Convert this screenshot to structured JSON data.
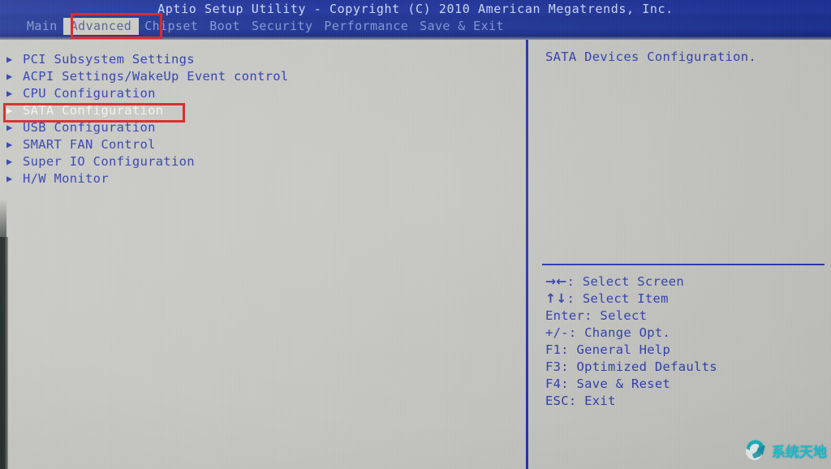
{
  "titlebar": {
    "text": "Aptio Setup Utility - Copyright (C) 2010 American Megatrends, Inc."
  },
  "menubar": {
    "items": [
      {
        "label": "Main",
        "active": false
      },
      {
        "label": "Advanced",
        "active": true
      },
      {
        "label": "Chipset",
        "active": false
      },
      {
        "label": "Boot",
        "active": false
      },
      {
        "label": "Security",
        "active": false
      },
      {
        "label": "Performance",
        "active": false
      },
      {
        "label": "Save & Exit",
        "active": false
      }
    ]
  },
  "main": {
    "options": [
      {
        "arrow": "▶",
        "label": "PCI Subsystem Settings",
        "selected": false
      },
      {
        "arrow": "▶",
        "label": "ACPI Settings/WakeUp Event control",
        "selected": false
      },
      {
        "arrow": "▶",
        "label": "CPU Configuration",
        "selected": false
      },
      {
        "arrow": "▶",
        "label": "SATA Configuration",
        "selected": true
      },
      {
        "arrow": "▶",
        "label": "USB Configuration",
        "selected": false
      },
      {
        "arrow": "▶",
        "label": "SMART FAN Control",
        "selected": false
      },
      {
        "arrow": "▶",
        "label": "Super IO Configuration",
        "selected": false
      },
      {
        "arrow": "▶",
        "label": "H/W Monitor",
        "selected": false
      }
    ]
  },
  "help": {
    "description": "SATA Devices Configuration.",
    "legend": [
      {
        "key": "→←",
        "text": ": Select Screen"
      },
      {
        "key": "↑↓",
        "text": ": Select Item"
      },
      {
        "key": "Enter",
        "text": ": Select"
      },
      {
        "key": "+/-",
        "text": ": Change Opt."
      },
      {
        "key": "F1",
        "text": ": General Help"
      },
      {
        "key": "F3",
        "text": ": Optimized Defaults"
      },
      {
        "key": "F4",
        "text": ": Save & Reset"
      },
      {
        "key": "ESC",
        "text": ": Exit"
      }
    ]
  },
  "annotations": [
    {
      "name": "advanced-tab-highlight",
      "target": "Advanced"
    },
    {
      "name": "sata-configuration-highlight",
      "target": "SATA Configuration"
    }
  ],
  "watermark": {
    "text": "系统天地"
  },
  "colors": {
    "titlebar_blue": "#1b2f96",
    "menubar_blue": "#18308f",
    "body_gray": "#c6c6c2",
    "text_blue": "#2436ad",
    "selected_text": "#f2f2f0",
    "annotation_red": "#d61a1a",
    "watermark_cyan": "#19c8d8"
  }
}
